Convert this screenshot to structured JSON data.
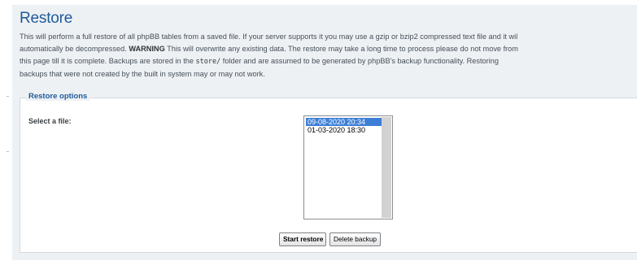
{
  "page": {
    "title": "Restore",
    "description": {
      "line1": "This will perform a full restore of all phpBB tables from a saved file. If your server supports it you may use a gzip or bzip2 compressed text file and it wil",
      "line2_before": "automatically be decompressed. ",
      "line2_warning": "WARNING",
      "line2_after": " This will overwrite any existing data. The restore may take a long time to process please do not move from",
      "line3_before": "this page till it is complete. Backups are stored in the ",
      "line3_code": "store/",
      "line3_after": " folder and are assumed to be generated by phpBB's backup functionality. Restoring",
      "line4": "backups that were not created by the built in system may or may not work."
    }
  },
  "restore_options": {
    "legend": "Restore options",
    "select_label": "Select a file:",
    "files": [
      {
        "label": "09-08-2020 20:34",
        "selected": true
      },
      {
        "label": "01-03-2020 18:30",
        "selected": false
      }
    ]
  },
  "actions": {
    "start_label": "Start restore",
    "delete_label": "Delete backup"
  },
  "colors": {
    "title": "#1e5a9a",
    "panel_background": "#eef1f4",
    "selection": "#3d7fd6"
  }
}
